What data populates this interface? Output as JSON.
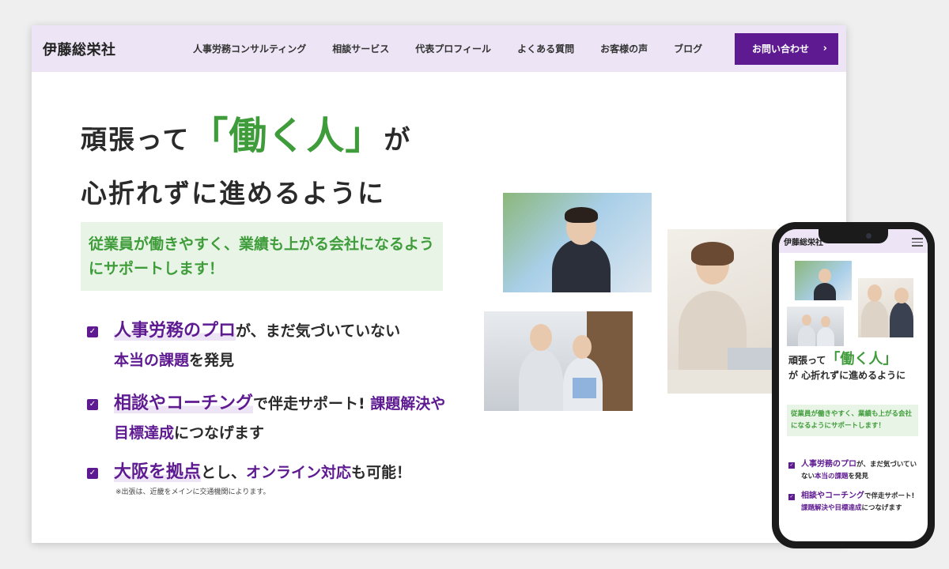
{
  "nav": {
    "logo": "伊藤総栄社",
    "items": [
      "人事労務コンサルティング",
      "相談サービス",
      "代表プロフィール",
      "よくある質問",
      "お客様の声",
      "ブログ"
    ],
    "cta": "お問い合わせ",
    "cta_arrow": "›"
  },
  "hero": {
    "line1_pre": "頑張って",
    "line1_big": "「働く人」",
    "line1_post": "が",
    "line2": "心折れずに進めるように",
    "lead": "従業員が働きやすく、業績も上がる会社になるようにサポートします！"
  },
  "features": [
    {
      "hl": "人事労務のプロ",
      "t1": "が、まだ気づいていない",
      "hl2": "本当の課題",
      "t2": "を発見"
    },
    {
      "hl": "相談やコーチング",
      "t1": "で伴走サポート! ",
      "hl2": "課題解決や目標達成",
      "t2": "につなげます"
    },
    {
      "hl": "大阪を拠点",
      "t1": "とし、",
      "hl2": "オンライン対応",
      "t2": "も可能！"
    }
  ],
  "note": "※出張は、近畿をメインに交通機関によります。",
  "check_glyph": "✓",
  "phone": {
    "logo": "伊藤総栄社",
    "title_pre": "頑張って",
    "title_big": "「働く人」",
    "title_post": "が 心折れずに進めるように",
    "lead": "従業員が働きやすく、業績も上がる会社になるようにサポートします！"
  },
  "colors": {
    "accent": "#5e1a91",
    "green": "#3f9c3a",
    "nav_bg": "#ede4f5",
    "lead_bg": "#e8f5e6"
  }
}
